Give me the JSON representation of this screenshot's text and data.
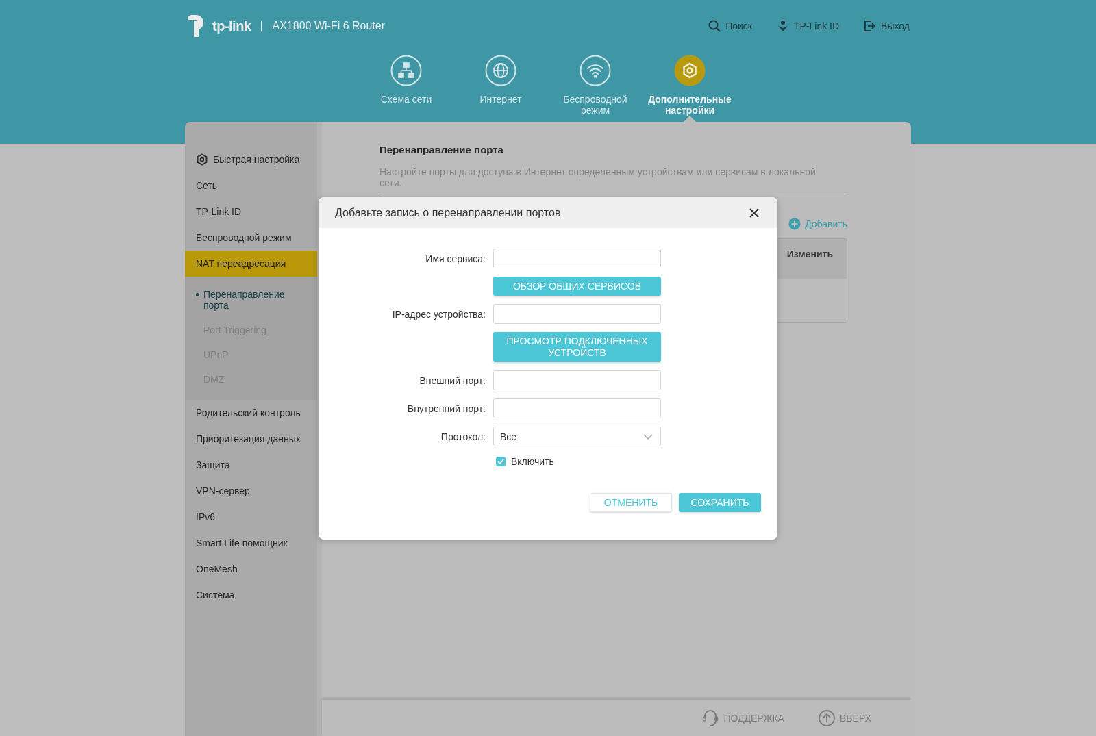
{
  "brand": {
    "logo": "tp-link",
    "model": "AX1800 Wi-Fi 6 Router"
  },
  "top_links": [
    {
      "kind": "search",
      "label": "Поиск"
    },
    {
      "kind": "id",
      "label": "TP-Link ID"
    },
    {
      "kind": "logout",
      "label": "Выход"
    }
  ],
  "nav_tabs": [
    {
      "kind": "network",
      "label": "Схема сети",
      "selected": false
    },
    {
      "kind": "internet",
      "label": "Интернет",
      "selected": false
    },
    {
      "kind": "wireless",
      "label": "Беспроводной режим",
      "selected": false
    },
    {
      "kind": "advanced",
      "label": "Дополнительные настройки",
      "selected": true
    }
  ],
  "sidebar": {
    "items": [
      {
        "label": "Быстрая настройка",
        "kind": "quick",
        "selected": false
      },
      {
        "label": "Сеть",
        "kind": "plain",
        "selected": false
      },
      {
        "label": "TP-Link ID",
        "kind": "plain",
        "selected": false
      },
      {
        "label": "Беспроводной режим",
        "kind": "plain",
        "selected": false
      },
      {
        "label": "NAT переадресация",
        "kind": "plain",
        "selected": true,
        "children": [
          {
            "label": "Перенаправление порта",
            "selected": true
          },
          {
            "label": "Port Triggering",
            "selected": false
          },
          {
            "label": "UPnP",
            "selected": false
          },
          {
            "label": "DMZ",
            "selected": false
          }
        ]
      },
      {
        "label": "Родительский контроль",
        "kind": "plain",
        "selected": false
      },
      {
        "label": "Приоритезация данных",
        "kind": "plain",
        "selected": false
      },
      {
        "label": "Защита",
        "kind": "plain",
        "selected": false
      },
      {
        "label": "VPN-сервер",
        "kind": "plain",
        "selected": false
      },
      {
        "label": "IPv6",
        "kind": "plain",
        "selected": false
      },
      {
        "label": "Smart Life помощник",
        "kind": "plain",
        "selected": false
      },
      {
        "label": "OneMesh",
        "kind": "plain",
        "selected": false
      },
      {
        "label": "Система",
        "kind": "plain",
        "selected": false
      }
    ]
  },
  "page": {
    "title": "Перенаправление порта",
    "description": "Настройте порты для доступа в Интернет определенным устройствам или сервисам в локальной сети.",
    "add_link": "Добавить",
    "table": {
      "columns": [
        "Изменить"
      ]
    }
  },
  "dialog": {
    "title": "Добавьте запись о перенаправлении портов",
    "fields": [
      {
        "kind": "text",
        "label": "Имя сервиса:"
      },
      {
        "kind": "button",
        "label": "ОБЗОР ОБЩИХ СЕРВИСОВ"
      },
      {
        "kind": "text",
        "label": "IP-адрес устройства:"
      },
      {
        "kind": "button",
        "label": "ПРОСМОТР ПОДКЛЮЧЕННЫХ УСТРОЙСТВ"
      },
      {
        "kind": "text",
        "label": "Внешний порт:"
      },
      {
        "kind": "text",
        "label": "Внутренний порт:"
      },
      {
        "kind": "select",
        "label": "Протокол:",
        "value": "Все"
      },
      {
        "kind": "checkbox",
        "label": "Включить",
        "checked": true
      }
    ],
    "buttons": [
      {
        "kind": "secondary",
        "label": "ОТМЕНИТЬ"
      },
      {
        "kind": "primary",
        "label": "СОХРАНИТЬ"
      }
    ]
  },
  "footer": [
    {
      "kind": "support",
      "label": "ПОДДЕРЖКА"
    },
    {
      "kind": "top",
      "label": "ВВЕРХ"
    }
  ]
}
